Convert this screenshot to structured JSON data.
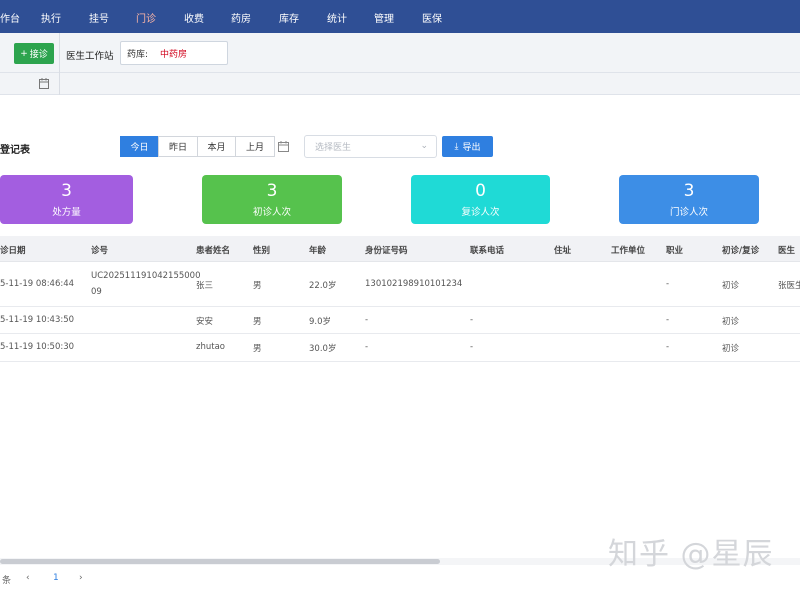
{
  "nav": {
    "items": [
      "作台",
      "执行",
      "挂号",
      "门诊",
      "收费",
      "药房",
      "库存",
      "统计",
      "管理",
      "医保"
    ],
    "active_index": 3
  },
  "toolbar": {
    "reception_label": "接诊",
    "workstation_label": "医生工作站",
    "pharmacy_label": "药库:",
    "pharmacy_value": "中药房"
  },
  "page": {
    "title": "登记表",
    "date_tabs": [
      "今日",
      "昨日",
      "本月",
      "上月"
    ],
    "active_tab": 0,
    "doctor_placeholder": "选择医生",
    "export_label": "导出"
  },
  "stats": [
    {
      "value": "3",
      "label": "处方量",
      "color": "#a35ee0"
    },
    {
      "value": "3",
      "label": "初诊人次",
      "color": "#56c24d"
    },
    {
      "value": "0",
      "label": "复诊人次",
      "color": "#1fdad6"
    },
    {
      "value": "3",
      "label": "门诊人次",
      "color": "#3d8ee6"
    }
  ],
  "table": {
    "headers": [
      "诊日期",
      "诊号",
      "患者姓名",
      "性别",
      "年龄",
      "身份证号码",
      "联系电话",
      "住址",
      "工作单位",
      "职业",
      "初诊/复诊",
      "医生"
    ],
    "rows": [
      {
        "date": "5-11-19 08:46:44",
        "no1": "UC202511191042155000",
        "no2": "09",
        "name": "张三",
        "gender": "男",
        "age": "22.0岁",
        "id": "130102198910101234",
        "phone": "",
        "address": "",
        "work": "",
        "job": "-",
        "visit": "初诊",
        "doctor": "张医生"
      },
      {
        "date": "5-11-19 10:43:50",
        "no1": "",
        "no2": "",
        "name": "安安",
        "gender": "男",
        "age": "9.0岁",
        "id": "-",
        "phone": "-",
        "address": "",
        "work": "",
        "job": "-",
        "visit": "初诊",
        "doctor": ""
      },
      {
        "date": "5-11-19 10:50:30",
        "no1": "",
        "no2": "",
        "name": "zhutao",
        "gender": "男",
        "age": "30.0岁",
        "id": "-",
        "phone": "-",
        "address": "",
        "work": "",
        "job": "-",
        "visit": "初诊",
        "doctor": ""
      }
    ]
  },
  "pager": {
    "total_suffix": "条",
    "prev": "‹",
    "page": "1",
    "next": "›"
  },
  "watermark": "知乎 @星辰"
}
